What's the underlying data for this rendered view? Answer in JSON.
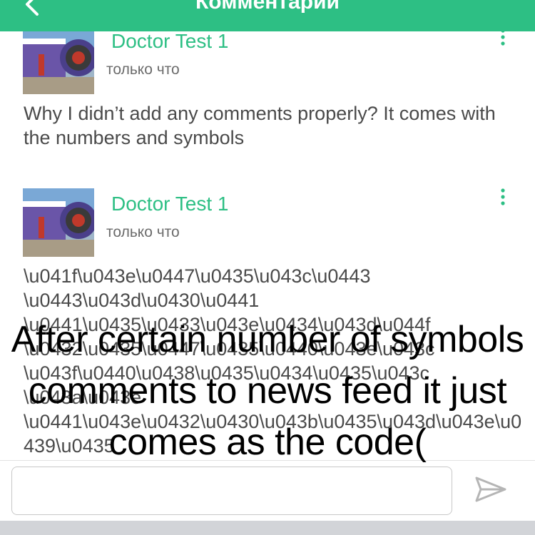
{
  "header": {
    "title": "Комментарии",
    "back_icon": "chevron-left-icon"
  },
  "comments": [
    {
      "author": "Doctor Test 1",
      "time": "только что",
      "text": "Why I didn’t add any comments properly? It comes with the numbers and symbols"
    },
    {
      "author": "Doctor Test 1",
      "time": "только что",
      "text": "\\u041f\\u043e\\u0447\\u0435\\u043c\\u0443 \\u0443\\u043d\\u0430\\u0441 \\u0441\\u0435\\u0433\\u043e\\u0434\\u043d\\u044f \\u0432\\u0435\\u0447\\u0435\\u0440\\u043e\\u043c \\u043f\\u0440\\u0438\\u0435\\u0434\\u0435\\u043c \\u043a\\u043e \\u0441\\u043e\\u0432\\u0430\\u043b\\u0435\\u043d\\u043e\\u0439\\u0435"
    }
  ],
  "composer": {
    "placeholder": "",
    "send_icon": "send-icon"
  },
  "overlay_caption": "After certain number of symbols comments to news feed it just comes as the code(",
  "colors": {
    "accent": "#2dbf84",
    "text": "#4a4a4a",
    "muted": "#6b6b6b"
  }
}
